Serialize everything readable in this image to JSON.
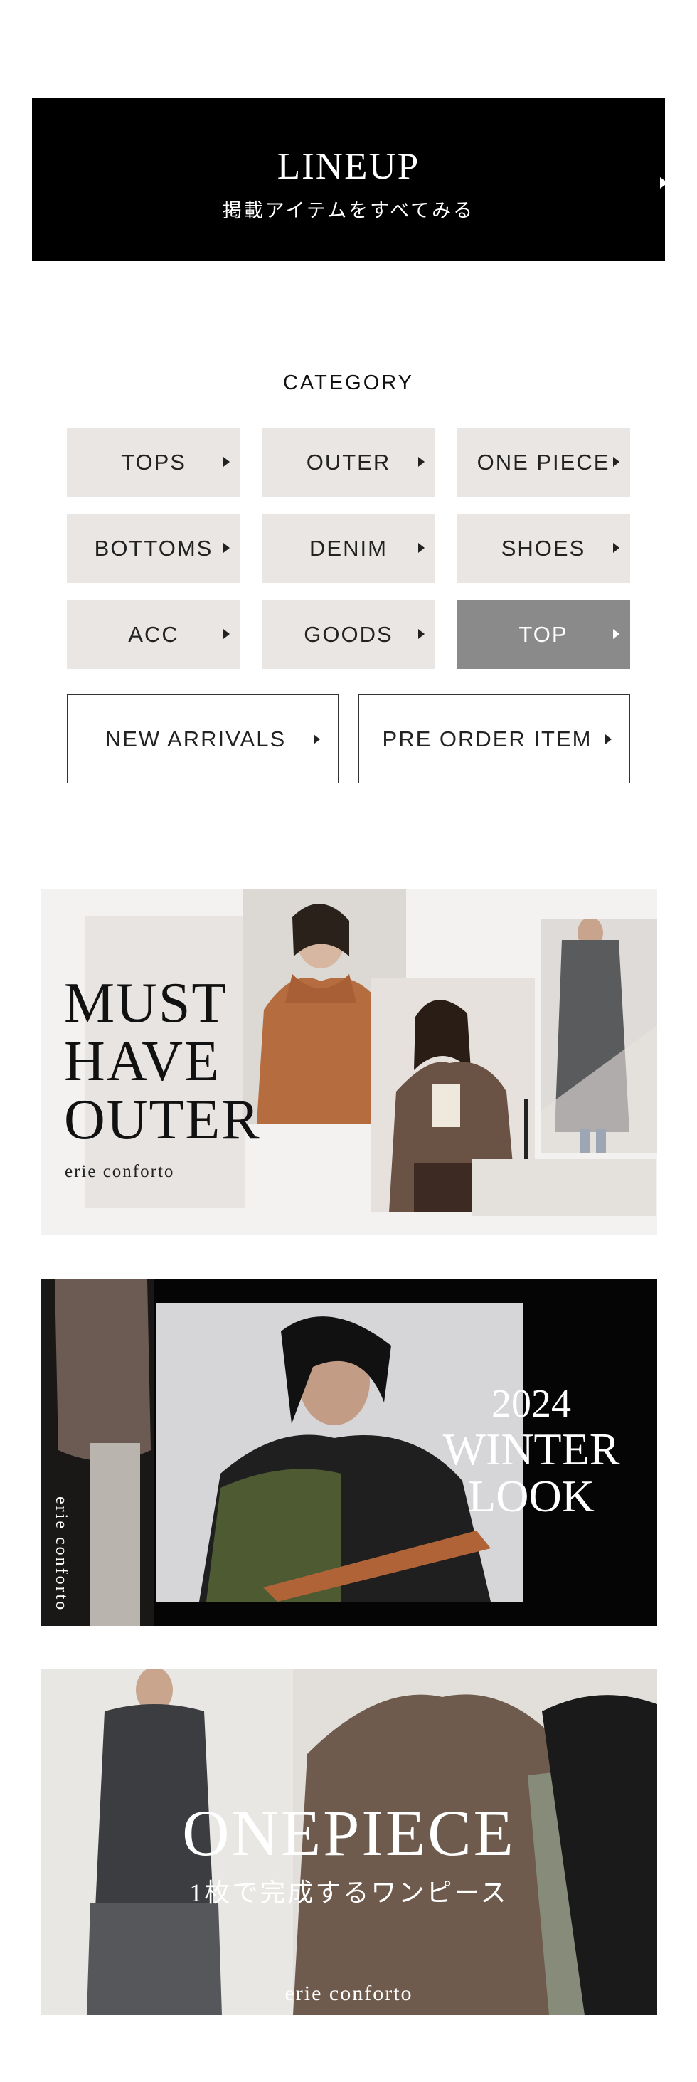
{
  "lineup": {
    "title": "LINEUP",
    "subtitle": "掲載アイテムをすべてみる"
  },
  "category": {
    "heading": "CATEGORY",
    "items": [
      {
        "label": "TOPS"
      },
      {
        "label": "OUTER"
      },
      {
        "label": "ONE PIECE"
      },
      {
        "label": "BOTTOMS"
      },
      {
        "label": "DENIM"
      },
      {
        "label": "SHOES"
      },
      {
        "label": "ACC"
      },
      {
        "label": "GOODS"
      },
      {
        "label": "TOP",
        "active": true
      }
    ],
    "new_arrivals": "NEW ARRIVALS",
    "pre_order": "PRE ORDER ITEM"
  },
  "banners": {
    "outer": {
      "line1": "MUST",
      "line2": "HAVE",
      "line3": "OUTER",
      "brand": "erie conforto"
    },
    "winter": {
      "year": "2024",
      "line1": "WINTER",
      "line2": "LOOK",
      "brand": "erie conforto"
    },
    "onepiece": {
      "title": "ONEPIECE",
      "subtitle": "1枚で完成するワンピース",
      "brand": "erie conforto"
    }
  },
  "colors": {
    "black": "#000000",
    "chip": "#e9e6e3",
    "chip_active": "#8a8a8a"
  }
}
